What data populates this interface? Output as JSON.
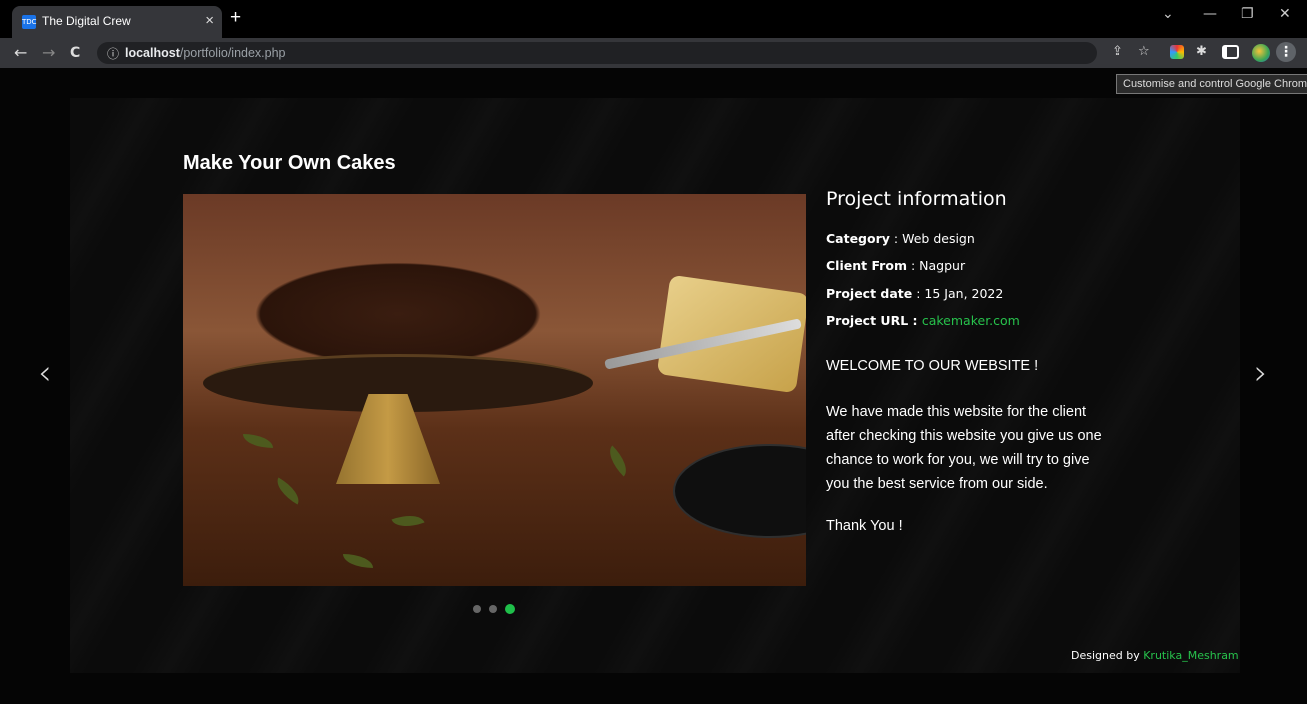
{
  "browser": {
    "tab_title": "The Digital Crew",
    "favicon_text": "TDC",
    "tab_close": "×",
    "new_tab": "+",
    "window_controls": {
      "minimize": "—",
      "restore": "❐",
      "close": "✕",
      "dropdown": "⌄"
    },
    "nav": {
      "back": "←",
      "forward": "→",
      "reload": "C"
    },
    "url_host": "localhost",
    "url_path": "/portfolio/index.php",
    "tooltip": "Customise and control Google Chrome",
    "menu_glyph": "⋮",
    "toolbar_icons": [
      "share-icon",
      "star-icon",
      "extension-color-icon",
      "puzzle-icon",
      "sidepanel-icon",
      "profile-avatar",
      "chrome-menu-icon"
    ]
  },
  "page": {
    "title": "Make Your Own Cakes",
    "info_title": "Project information",
    "category_label": "Category",
    "category_value": "Web design",
    "client_label": "Client From",
    "client_value": "Nagpur",
    "date_label": "Project date",
    "date_value": "15 Jan, 2022",
    "url_label": "Project URL",
    "url_value": "cakemaker.com",
    "separator": " : ",
    "welcome": "WELCOME TO OUR WEBSITE !",
    "description_lines": [
      "We have made this website for the client",
      "after checking this website you give us one",
      "chance to work for you, we will try to give",
      "you the best service from our side."
    ],
    "thanks": "Thank You !",
    "credit_prefix": "Designed by",
    "credit_name": "Krutika_Meshram",
    "prev_arrow": "‹",
    "next_arrow": "›",
    "close_glyph": "^",
    "slide_count": 3,
    "active_slide": 3,
    "accent": "#27c24c"
  }
}
